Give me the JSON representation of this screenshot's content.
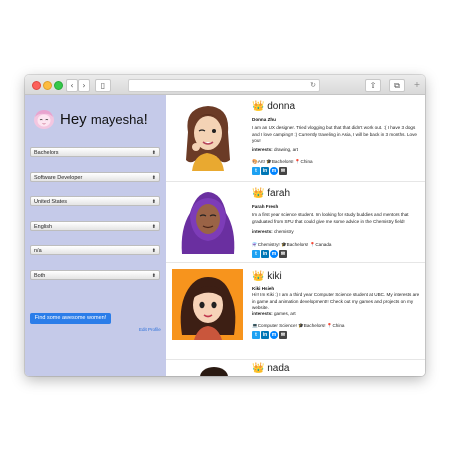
{
  "browser": {
    "back_glyph": "‹",
    "forward_glyph": "›",
    "sidebar_glyph": "▯",
    "reload_glyph": "↻",
    "share_glyph": "⇧",
    "tabs_glyph": "⧉",
    "plus_glyph": "+"
  },
  "sidebar": {
    "greeting": "Hey",
    "username": "mayesha",
    "exclaim": "!",
    "filters": [
      {
        "value": "Bachelors"
      },
      {
        "value": "Software Developer"
      },
      {
        "value": "United States"
      },
      {
        "value": "English"
      },
      {
        "value": "n/a"
      },
      {
        "value": "Both"
      }
    ],
    "caret_glyph": "⬍",
    "find_button": "Find some awesome women!",
    "edit_profile": "Edit Profile"
  },
  "profiles": [
    {
      "crown": "👑",
      "name": "donna",
      "full_name": "Donna Zhu",
      "bio": "I am an UX designer. Tried vlogging but that that didn't work out. :( I have 3 dogs and I love camping!! :) Currently traveling in Asia, I will be back in 3 months. Love you!",
      "interests_label": "interests:",
      "interests": "drawing, art",
      "tags": "🎨Art! 🎓Bachelors! 📍China"
    },
    {
      "crown": "👑",
      "name": "farah",
      "full_name": "Farah Fresh",
      "bio": "Im a first year science student. Im looking for study buddies and mentors that graduated from SFU that could give me some advice in the Chemistry field!",
      "interests_label": "interests:",
      "interests": "chemistry",
      "tags": "⚗️Chemistry! 🎓Bachelors! 📍Canada"
    },
    {
      "crown": "👑",
      "name": "kiki",
      "full_name": "Kiki Hsieh",
      "bio": "Hi!! Im Kiki :) I am a third year Computer Science student at UBC. My interests are in game and animation development!! Check out my games and projects on my website.",
      "interests_label": "interests:",
      "interests": "games, art",
      "tags": "💻Computer Science! 🎓Bachelors! 📍China"
    },
    {
      "crown": "👑",
      "name": "nada"
    }
  ],
  "social_icons": [
    {
      "icon": "twitter-icon",
      "glyph": "t",
      "color": "#1da1f2"
    },
    {
      "icon": "linkedin-icon",
      "glyph": "in",
      "color": "#0077b5"
    },
    {
      "icon": "messenger-icon",
      "glyph": "m",
      "color": "#0084ff"
    },
    {
      "icon": "mail-icon",
      "glyph": "✉",
      "color": "#444444"
    }
  ],
  "colors": {
    "sidebar_bg": "#c5cae9",
    "button_blue": "#2b7de9",
    "link_blue": "#2b6fd9"
  }
}
